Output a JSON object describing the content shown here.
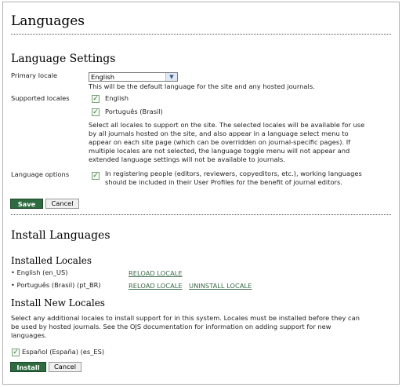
{
  "page": {
    "title": "Languages"
  },
  "settings": {
    "heading": "Language Settings",
    "primary_label": "Primary locale",
    "primary_value": "English",
    "primary_help": "This will be the default language for the site and any hosted journals.",
    "supported_label": "Supported locales",
    "supported": [
      "English",
      "Português (Brasil)"
    ],
    "supported_help": [
      "Select all locales to support on the site. The selected locales will be available for use",
      "by all journals hosted on the site, and also appear in a language select menu to",
      "appear on each site page (which can be overridden on journal-specific pages). If",
      "multiple locales are not selected, the language toggle menu will not appear and",
      "extended language settings will not be available to journals."
    ],
    "options_label": "Language options",
    "options_text": [
      "In registering people (editors, reviewers, copyeditors, etc.), working languages",
      "should be included in their User Profiles for the benefit of journal editors."
    ],
    "save": "Save",
    "cancel": "Cancel"
  },
  "install": {
    "heading": "Install Languages",
    "installed_heading": "Installed Locales",
    "installed": [
      {
        "name": "• English (en_US)",
        "reload": "RELOAD LOCALE",
        "uninstall": ""
      },
      {
        "name": "• Português (Brasil) (pt_BR)",
        "reload": "RELOAD LOCALE",
        "uninstall": "UNINSTALL LOCALE"
      }
    ],
    "new_heading": "Install New Locales",
    "new_help": [
      "Select any additional locales to install support for in this system. Locales must be installed before they can",
      "be used by hosted journals. See the OJS documentation for information on adding support for new",
      "languages."
    ],
    "new_locale": "Español (España) (es_ES)",
    "install": "Install",
    "cancel": "Cancel"
  },
  "colors": {
    "button": "#2e6b40",
    "link": "#3a6b4a"
  }
}
